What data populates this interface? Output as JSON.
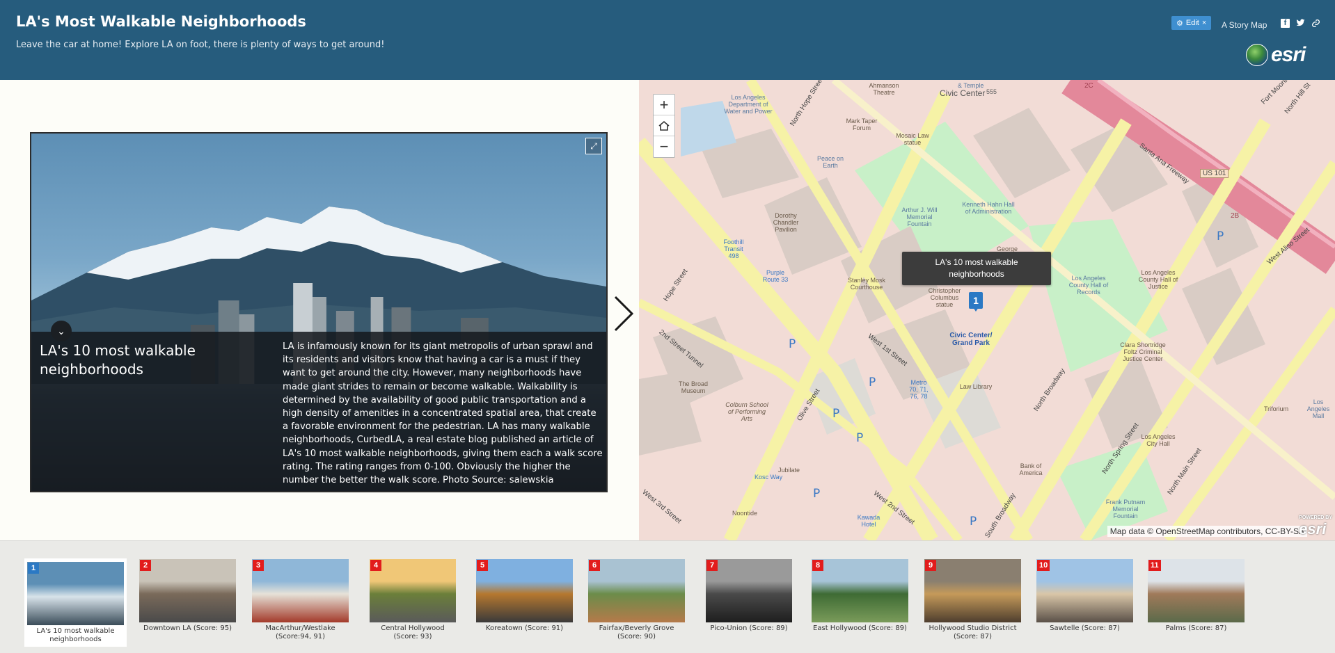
{
  "header": {
    "title": "LA's Most Walkable Neighborhoods",
    "subtitle": "Leave the car at home! Explore LA on foot, there is plenty of ways to get around!",
    "edit_label": "Edit",
    "story_map_label": "A Story Map",
    "brand": "esri",
    "share_icons": [
      "facebook-icon",
      "twitter-icon",
      "link-icon"
    ]
  },
  "media": {
    "caption_title": "LA's 10 most walkable neighborhoods",
    "caption_body": "LA is infamously known for its giant metropolis of urban sprawl and its residents and visitors know that having a car is a must if they want to get around the city. However, many neighborhoods have made giant strides to remain or become walkable. Walkability is determined by the availability of good public transportation and a high density of amenities in a concentrated spatial area, that create a favorable environment for the pedestrian. LA has many walkable neighborhoods, CurbedLA, a real estate blog published an article of LA's 10 most walkable neighborhoods, giving them each a walk score rating. The rating ranges from 0-100. Obviously the higher the number the better the walk score. Photo Source: salewskia"
  },
  "map": {
    "popup_text": "LA's 10 most walkable neighborhoods",
    "marker_number": "1",
    "attribution": "Map data © OpenStreetMap contributors, CC-BY-SA",
    "logo_small": "POWERED BY",
    "logo": "esri",
    "labels": {
      "civic_center": "Civic Center",
      "music_center": "& Temple",
      "num555": "555",
      "c2": "2C",
      "la_dwp": "Los Angeles Department of Water and Power",
      "ahmanson": "Ahmanson Theatre",
      "mark_taper": "Mark Taper Forum",
      "mosaic": "Mosaic Law statue",
      "peace": "Peace on Earth",
      "north_hope": "North Hope Street",
      "arthur": "Arthur J. Will Memorial Fountain",
      "kenneth": "Kenneth Hahn Hall of Administration",
      "dorothy": "Dorothy Chandler Pavilion",
      "footHill498a": "Foothill Transit 498",
      "purple": "Purple Route 33",
      "stanley": "Stanley Mosk Courthouse",
      "christopher": "Christopher Columbus statue",
      "civic_park": "Civic Center/ Grand Park",
      "la_hall": "Los Angeles County Hall of Records",
      "hall_justice": "Los Angeles County Hall of Justice",
      "clara": "Clara Shortridge Foltz Criminal Justice Center",
      "law_library": "Law Library",
      "west_1st": "West 1st Street",
      "north_bway": "North Broadway",
      "north_spring": "North Spring Street",
      "north_main": "North Main Street",
      "la_city_hall": "Los Angeles City Hall",
      "broad": "The Broad Museum",
      "colburn": "Colburn School of Performing Arts",
      "olive": "Olive Street",
      "hope": "Hope Street",
      "street_2nd_tunnel": "2nd Street Tunnel",
      "west_3rd": "West 3rd Street",
      "jubilate": "Jubilate",
      "kosc": "Kosc Way",
      "noontide": "Noontide",
      "kawada": "Kawada Hotel",
      "west_2nd": "West 2nd Street",
      "south_bway": "South Broadway",
      "bank": "Bank of America",
      "frank": "Frank Putnam Memorial Fountain",
      "us101": "US 101",
      "santa_ana": "Santa Ana Freeway",
      "fort_moore": "Fort Moore",
      "north_hill": "North Hill St",
      "west_aliso": "West Aliso Street",
      "triforium": "Triforium",
      "la_mall": "Los Angeles Mall",
      "metro_a": "Metro 70, 71, 76, 78",
      "b2": "2B",
      "georg": "George"
    }
  },
  "thumbnails": [
    {
      "num": "1",
      "label": "LA's 10 most walkable neighborhoods",
      "colors": [
        "#5d8fb5",
        "#d8e3ea",
        "#3a4c59"
      ]
    },
    {
      "num": "2",
      "label": "Downtown LA (Score: 95)",
      "colors": [
        "#c9c3b8",
        "#7a6a5a",
        "#4a4a4a"
      ]
    },
    {
      "num": "3",
      "label": "MacArthur/Westlake (Score:94, 91)",
      "colors": [
        "#8fb7d8",
        "#e6e2d8",
        "#a33a2a"
      ]
    },
    {
      "num": "4",
      "label": "Central Hollywood (Score: 93)",
      "colors": [
        "#f0c777",
        "#6b7f3a",
        "#5a5a5a"
      ]
    },
    {
      "num": "5",
      "label": "Koreatown (Score: 91)",
      "colors": [
        "#7fb0e0",
        "#b5782f",
        "#3a3a3a"
      ]
    },
    {
      "num": "6",
      "label": "Fairfax/Beverly Grove (Score: 90)",
      "colors": [
        "#a9c2d2",
        "#6b8c4a",
        "#b57a4a"
      ]
    },
    {
      "num": "7",
      "label": "Pico-Union (Score: 89)",
      "colors": [
        "#9a9a9a",
        "#4a4a4a",
        "#1e1e1e"
      ]
    },
    {
      "num": "8",
      "label": "East Hollywood (Score: 89)",
      "colors": [
        "#a7c4d8",
        "#3e6b34",
        "#7a9b5a"
      ]
    },
    {
      "num": "9",
      "label": "Hollywood Studio District (Score: 87)",
      "colors": [
        "#8a7f70",
        "#c59a5a",
        "#4e3e2e"
      ]
    },
    {
      "num": "10",
      "label": "Sawtelle (Score: 87)",
      "colors": [
        "#9fc3e5",
        "#d9c6a8",
        "#5a5048"
      ]
    },
    {
      "num": "11",
      "label": "Palms (Score: 87)",
      "colors": [
        "#dde3e8",
        "#a07a5a",
        "#5b6a4a"
      ]
    }
  ],
  "accent": "#265c7d"
}
